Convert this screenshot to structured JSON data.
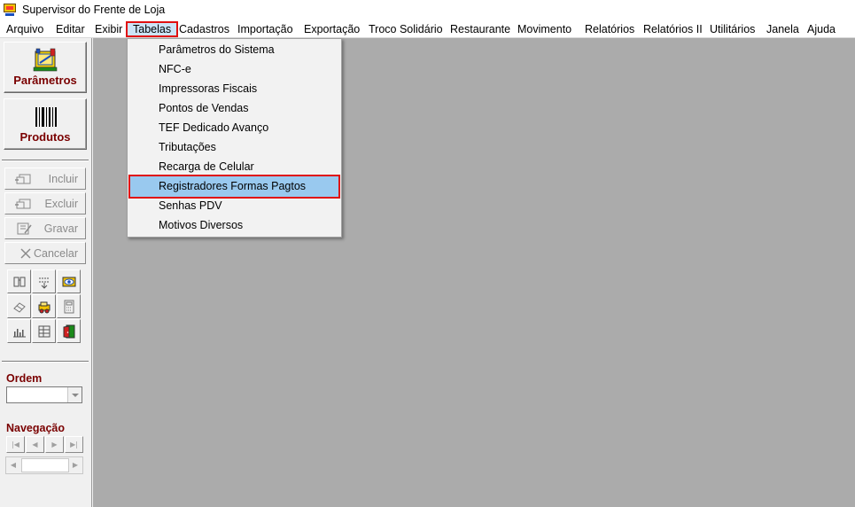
{
  "window": {
    "title": "Supervisor do Frente de Loja"
  },
  "menubar": {
    "items": [
      {
        "label": "Arquivo"
      },
      {
        "label": "Editar"
      },
      {
        "label": "Exibir"
      },
      {
        "label": "Tabelas"
      },
      {
        "label": "Cadastros"
      },
      {
        "label": "Importação"
      },
      {
        "label": "Exportação"
      },
      {
        "label": "Troco Solidário"
      },
      {
        "label": "Restaurante"
      },
      {
        "label": "Movimento"
      },
      {
        "label": "Relatórios"
      },
      {
        "label": "Relatórios II"
      },
      {
        "label": "Utilitários"
      },
      {
        "label": "Janela"
      },
      {
        "label": "Ajuda"
      }
    ],
    "active": "Tabelas"
  },
  "dropdown": {
    "items": [
      {
        "label": "Parâmetros do Sistema"
      },
      {
        "label": "NFC-e"
      },
      {
        "label": "Impressoras Fiscais"
      },
      {
        "label": "Pontos de Vendas"
      },
      {
        "label": "TEF Dedicado Avanço"
      },
      {
        "label": "Tributações"
      },
      {
        "label": "Recarga de Celular"
      },
      {
        "label": "Registradores Formas Pagtos"
      },
      {
        "label": "Senhas PDV"
      },
      {
        "label": "Motivos Diversos"
      }
    ],
    "highlighted": "Registradores Formas Pagtos"
  },
  "sidebar": {
    "big_buttons": [
      {
        "label": "Parâmetros",
        "icon": "parameters-icon"
      },
      {
        "label": "Produtos",
        "icon": "barcode-icon"
      }
    ],
    "actions": [
      {
        "label": "Incluir",
        "icon": "add-record-icon"
      },
      {
        "label": "Excluir",
        "icon": "delete-record-icon"
      },
      {
        "label": "Gravar",
        "icon": "save-record-icon"
      },
      {
        "label": "Cancelar",
        "icon": "cancel-x-icon"
      }
    ],
    "tools": [
      "binoculars-icon",
      "sort-icon",
      "view-eye-icon",
      "eraser-icon",
      "vehicle-icon",
      "calculator-icon",
      "bar-chart-icon",
      "table-edit-icon",
      "exit-door-icon"
    ],
    "ordem_label": "Ordem",
    "ordem_value": "",
    "navegacao_label": "Navegação",
    "nav_buttons": [
      "first-record-icon",
      "prev-record-icon",
      "next-record-icon",
      "last-record-icon"
    ]
  },
  "colors": {
    "accent_label": "#7a0000",
    "highlight_border": "#e01010",
    "menu_selection": "#99c9ef",
    "workspace_bg": "#ababab"
  }
}
